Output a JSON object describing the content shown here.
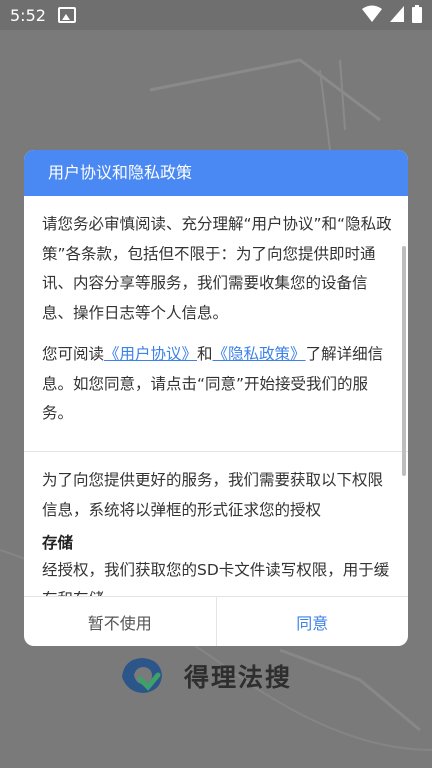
{
  "status_bar": {
    "time": "5:52"
  },
  "dialog": {
    "title": "用户协议和隐私政策",
    "paragraph1": "请您务必审慎阅读、充分理解“用户协议”和“隐私政策”各条款，包括但不限于：为了向您提供即时通讯、内容分享等服务，我们需要收集您的设备信息、操作日志等个人信息。",
    "paragraph2": {
      "prefix": "您可阅读",
      "link1": "《用户协议》",
      "middle": "和",
      "link2": "《隐私政策》",
      "suffix": "了解详细信息。如您同意，请点击“同意”开始接受我们的服务。"
    },
    "permissions_intro": "为了向您提供更好的服务，我们需要获取以下权限信息，系统将以弹框的形式征求您的授权",
    "permission": {
      "title": "存储",
      "description": "经授权，我们获取您的SD卡文件读写权限，用于缓存和存储"
    },
    "buttons": {
      "cancel": "暂不使用",
      "agree": "同意"
    }
  },
  "app": {
    "name": "得理法搜"
  },
  "colors": {
    "accent": "#4a89f3",
    "link": "#3d82e8"
  }
}
